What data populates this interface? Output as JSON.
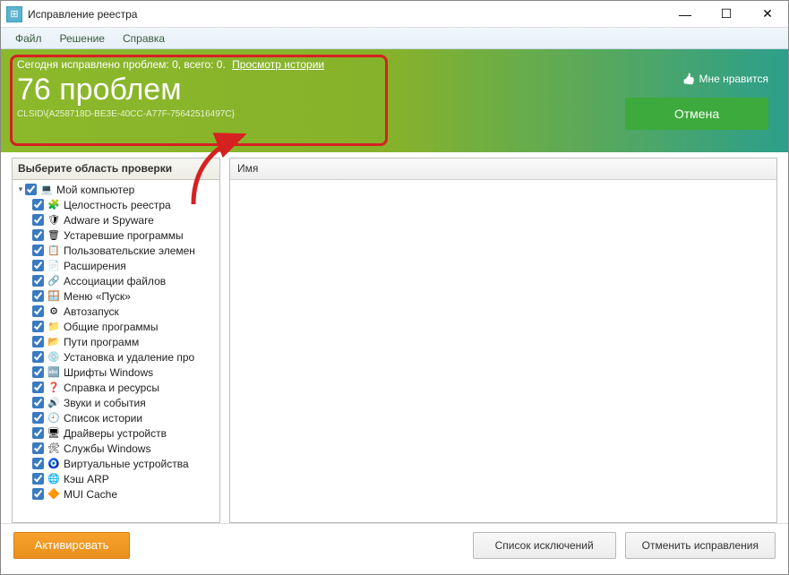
{
  "window": {
    "title": "Исправление реестра"
  },
  "menu": {
    "file": "Файл",
    "solution": "Решение",
    "help": "Справка"
  },
  "banner": {
    "stats_prefix": "Сегодня исправлено проблем: ",
    "fixed": "0",
    "sep": ", всего: ",
    "total": "0",
    "history_link": "Просмотр истории",
    "count_text": "76 проблем",
    "clsid": "CLSID\\{A258718D-BE3E-40CC-A77F-75642516497C}",
    "like": "Мне нравится",
    "cancel": "Отмена"
  },
  "left": {
    "header": "Выберите область проверки",
    "root": {
      "label": "Мой компьютер",
      "icon": "💻"
    },
    "items": [
      {
        "label": "Целостность реестра",
        "icon": "🧩"
      },
      {
        "label": "Adware и Spyware",
        "icon": "🛡"
      },
      {
        "label": "Устаревшие программы",
        "icon": "🗑"
      },
      {
        "label": "Пользовательские элемен",
        "icon": "📋"
      },
      {
        "label": "Расширения",
        "icon": "📄"
      },
      {
        "label": "Ассоциации файлов",
        "icon": "🔗"
      },
      {
        "label": "Меню «Пуск»",
        "icon": "🪟"
      },
      {
        "label": "Автозапуск",
        "icon": "⚙"
      },
      {
        "label": "Общие программы",
        "icon": "📁"
      },
      {
        "label": "Пути программ",
        "icon": "📂"
      },
      {
        "label": "Установка и удаление про",
        "icon": "💿"
      },
      {
        "label": "Шрифты Windows",
        "icon": "🔤"
      },
      {
        "label": "Справка и ресурсы",
        "icon": "❓"
      },
      {
        "label": "Звуки и события",
        "icon": "🔊"
      },
      {
        "label": "Список истории",
        "icon": "🕘"
      },
      {
        "label": "Драйверы устройств",
        "icon": "🖥"
      },
      {
        "label": "Службы Windows",
        "icon": "🛠"
      },
      {
        "label": "Виртуальные устройства",
        "icon": "🧿"
      },
      {
        "label": "Кэш ARP",
        "icon": "🌐"
      },
      {
        "label": "MUI Cache",
        "icon": "🔶"
      }
    ]
  },
  "right": {
    "header": "Имя"
  },
  "bottom": {
    "activate": "Активировать",
    "exclusions": "Список исключений",
    "undo": "Отменить исправления"
  }
}
